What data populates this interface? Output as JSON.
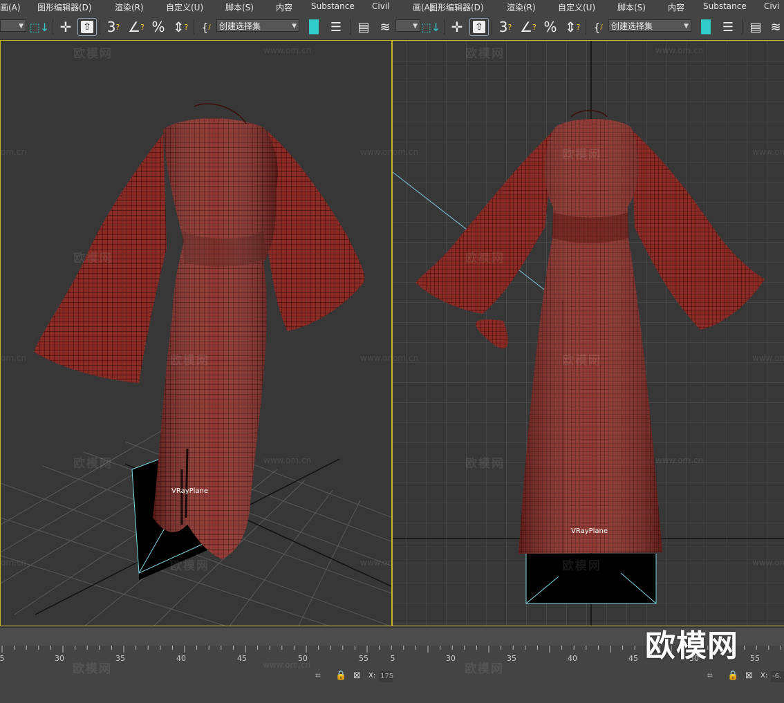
{
  "menu_left": [
    "画(A)",
    "图形编辑器(D)",
    "渲染(R)",
    "自定义(U)",
    "脚本(S)",
    "内容",
    "Substance",
    "Civil"
  ],
  "menu_right": [
    "画(A)",
    "图形编辑器(D)",
    "渲染(R)",
    "自定义(U)",
    "脚本(S)",
    "内容",
    "Substance",
    "Civi"
  ],
  "toolbar": {
    "selection_set_left": "创建选择集",
    "selection_set_right": "创建选择集",
    "snap_label": "3",
    "percent_label": "%"
  },
  "viewports": {
    "left_object_label": "VRayPlane",
    "right_object_label": "VRayPlane"
  },
  "watermarks": {
    "brand": "欧模网",
    "url": "www.om.cn",
    "url_short": "om.cn"
  },
  "timeline": {
    "left_ticks": [
      "5",
      "30",
      "35",
      "40",
      "45",
      "50",
      "55",
      "5"
    ],
    "right_ticks": [
      "30",
      "35",
      "40",
      "45",
      "50",
      "55"
    ]
  },
  "status": {
    "x_label_left": "X:",
    "x_value_left": "175",
    "x_label_right": "X:",
    "x_value_right": "-6."
  },
  "colors": {
    "viewport_border": "#c9b52a",
    "garment": "#8a2a24",
    "selection_edge": "#7fd8e6"
  }
}
